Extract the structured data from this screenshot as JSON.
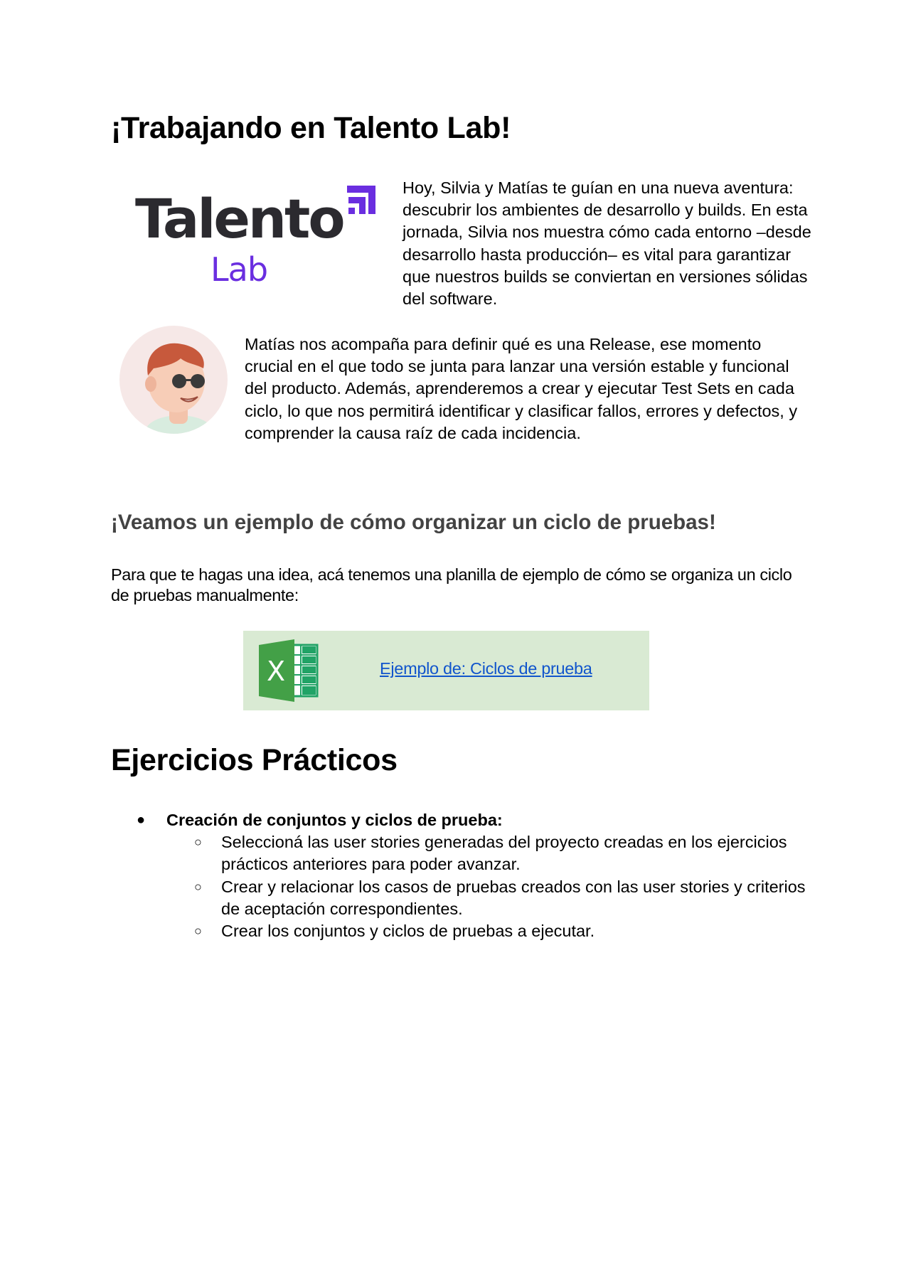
{
  "heading_main": "¡Trabajando en Talento Lab!",
  "logo": {
    "word": "Talento",
    "sub": "Lab",
    "colors": {
      "word": "#2b2a2f",
      "accent": "#6a2ee0"
    }
  },
  "intro_paragraph": "Hoy, Silvia y Matías te guían en una nueva aventura: descubrir los ambientes de desarrollo y builds. En esta jornada, Silvia nos muestra cómo cada entorno –desde desarrollo hasta producción– es vital para garantizar que nuestros builds se conviertan en versiones sólidas del software.",
  "avatar_icon": "avatar-illustration",
  "release_paragraph": "Matías nos acompaña para definir qué es una Release, ese momento crucial en el que todo se junta para lanzar una versión estable y funcional del producto. Además, aprenderemos a crear y ejecutar Test Sets en cada ciclo, lo que nos permitirá identificar y clasificar fallos, errores y defectos, y comprender la causa raíz de cada incidencia.",
  "example_heading": "¡Veamos un ejemplo de cómo organizar un ciclo de pruebas!",
  "example_paragraph": "Para que te hagas una idea, acá tenemos una planilla de ejemplo de cómo se organiza un ciclo de pruebas manualmente:",
  "link_box": {
    "icon": "excel-icon",
    "link_text": "Ejemplo de: Ciclos de prueba",
    "background": "#d9ead3",
    "link_color": "#1155cc"
  },
  "exercises_heading": "Ejercicios Prácticos",
  "exercises": {
    "item_label": "Creación de conjuntos y ciclos de prueba:",
    "subitems": [
      "Seleccioná  las user stories generadas del proyecto creadas en los ejercicios prácticos anteriores para poder avanzar.",
      "Crear y relacionar los casos de pruebas creados con las user stories y criterios de aceptación correspondientes.",
      "Crear los conjuntos y ciclos de pruebas a ejecutar."
    ]
  }
}
